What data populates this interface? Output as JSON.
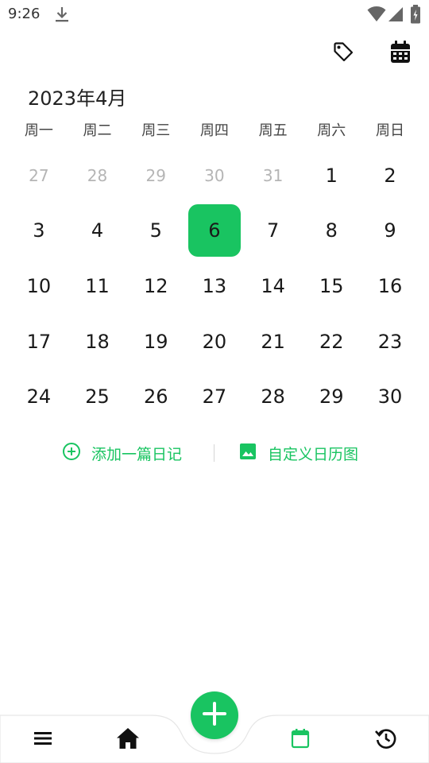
{
  "status_bar": {
    "time": "9:26"
  },
  "calendar": {
    "month_title": "2023年4月",
    "weekdays": [
      "周一",
      "周二",
      "周三",
      "周四",
      "周五",
      "周六",
      "周日"
    ],
    "days": [
      {
        "label": "27",
        "muted": true
      },
      {
        "label": "28",
        "muted": true
      },
      {
        "label": "29",
        "muted": true
      },
      {
        "label": "30",
        "muted": true
      },
      {
        "label": "31",
        "muted": true
      },
      {
        "label": "1"
      },
      {
        "label": "2"
      },
      {
        "label": "3"
      },
      {
        "label": "4"
      },
      {
        "label": "5"
      },
      {
        "label": "6",
        "selected": true
      },
      {
        "label": "7"
      },
      {
        "label": "8"
      },
      {
        "label": "9"
      },
      {
        "label": "10"
      },
      {
        "label": "11"
      },
      {
        "label": "12"
      },
      {
        "label": "13"
      },
      {
        "label": "14"
      },
      {
        "label": "15"
      },
      {
        "label": "16"
      },
      {
        "label": "17"
      },
      {
        "label": "18"
      },
      {
        "label": "19"
      },
      {
        "label": "20"
      },
      {
        "label": "21"
      },
      {
        "label": "22"
      },
      {
        "label": "23"
      },
      {
        "label": "24"
      },
      {
        "label": "25"
      },
      {
        "label": "26"
      },
      {
        "label": "27"
      },
      {
        "label": "28"
      },
      {
        "label": "29"
      },
      {
        "label": "30"
      }
    ]
  },
  "actions": {
    "add_label": "添加一篇日记",
    "custom_label": "自定义日历图"
  },
  "icons": {
    "top_bar": [
      "tag-icon",
      "calendar-icon"
    ],
    "actions": [
      "add-circle-icon",
      "image-icon"
    ],
    "bottom_nav": [
      "menu-icon",
      "home-icon",
      "plus-icon",
      "calendar-icon",
      "history-icon"
    ]
  },
  "colors": {
    "accent": "#19c461",
    "muted_day": "#b5b5b5",
    "text": "#1a1a1a"
  }
}
